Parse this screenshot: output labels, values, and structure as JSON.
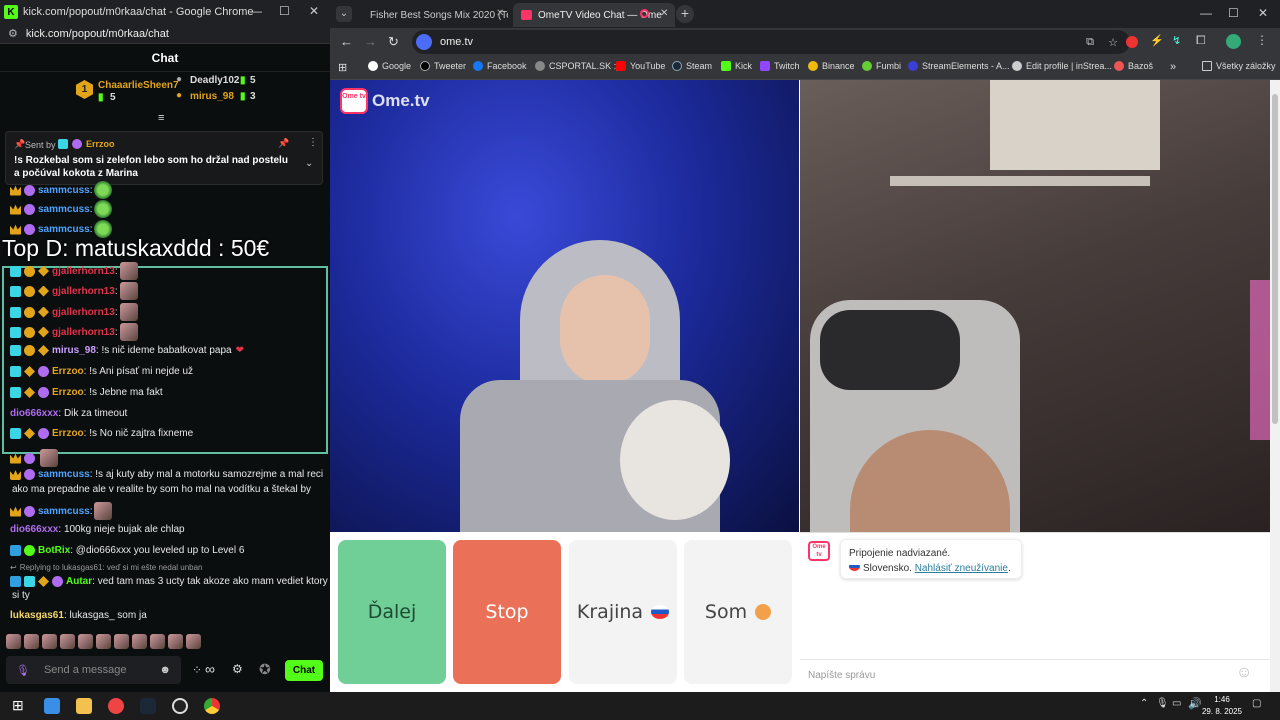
{
  "kick": {
    "window_title": "kick.com/popout/m0rkaa/chat - Google Chrome",
    "url": "kick.com/popout/m0rkaa/chat",
    "chat_header": "Chat",
    "leaderboard": [
      {
        "name": "ChaaarlieSheen7",
        "count": "5"
      },
      {
        "name": "Deadly102",
        "count": "5"
      },
      {
        "name": "mirus_98",
        "count": "3"
      }
    ],
    "pinned": {
      "sent_by_label": "Sent by",
      "sender": "Errzoo",
      "text": "!s Rozkebal som si zelefon lebo som ho držal nad postelu a počúval kokota z Marina"
    },
    "overlay_top": "Top D: matuskaxddd : 50€",
    "messages": [
      {
        "user": "sammcuss",
        "text": ""
      },
      {
        "user": "sammcuss",
        "text": ""
      },
      {
        "user": "sammcuss",
        "text": ""
      },
      {
        "user": "gjallerhorn13",
        "text": ""
      },
      {
        "user": "gjallerhorn13",
        "text": ""
      },
      {
        "user": "gjallerhorn13",
        "text": ""
      },
      {
        "user": "gjallerhorn13",
        "text": ""
      },
      {
        "user": "mirus_98",
        "text": "!s nič ideme babatkovat papa"
      },
      {
        "user": "Errzoo",
        "text": "!s Ani písať mi nejde už"
      },
      {
        "user": "Errzoo",
        "text": "!s Jebne ma fakt"
      },
      {
        "user": "dio666xxx",
        "text": "Dik za timeout"
      },
      {
        "user": "Errzoo",
        "text": "!s No nič zajtra fixneme"
      },
      {
        "user": "sammcuss",
        "text": "!s aj kuty aby mal a motorku samozrejme a mal reci"
      },
      {
        "user": "",
        "text": "ako ma prepadne ale v realite by som ho mal na vodítku a štekal by"
      },
      {
        "user": "sammcuss",
        "text": ""
      },
      {
        "user": "dio666xxx",
        "text": "100kg nieje bujak ale chlap"
      },
      {
        "user": "BotRix",
        "text": "@dio666xxx you leveled up to Level 6"
      },
      {
        "user": "",
        "text": "Replying to lukasgas61: veď si mi ešte nedal unban"
      },
      {
        "user": "Autar",
        "text": "ved tam mas 3 ucty tak akoze ako mam vediet ktory"
      },
      {
        "user": "",
        "text": "si ty"
      },
      {
        "user": "lukasgas61",
        "text": "lukasgas_ som ja"
      }
    ],
    "composer_placeholder": "Send a message",
    "chat_button": "Chat",
    "infinity": "∞"
  },
  "chrome": {
    "tabs": [
      {
        "title": "Fisher Best Songs Mix 2020 (Te"
      },
      {
        "title": "OmeTV Video Chat — Ome"
      }
    ],
    "url": "ome.tv",
    "bookmarks": [
      "Google",
      "Tweeter",
      "Facebook",
      "CSPORTAL.SK :)",
      "YouTube",
      "Steam",
      "Kick",
      "Twitch",
      "Binance",
      "Fumbi",
      "StreamElements - A...",
      "Edit profile | inStrea...",
      "Bazoš"
    ],
    "all_bookmarks": "Všetky záložky"
  },
  "ometv": {
    "logo": "Ome.tv",
    "logo_badge": "Ome tv",
    "buttons": {
      "next": "Ďalej",
      "stop": "Stop",
      "country": "Krajina",
      "me": "Som"
    },
    "status_line1": "Pripojenie nadviazané.",
    "status_country": "Slovensko.",
    "report_link": "Nahlásiť zneužívanie",
    "input_placeholder": "Napíšte správu"
  },
  "taskbar": {
    "time": "1:46",
    "date": "29. 8. 2025"
  },
  "colors": {
    "kick_green": "#53fc18",
    "next_green": "#6fcf97",
    "stop_red": "#ea7158"
  }
}
